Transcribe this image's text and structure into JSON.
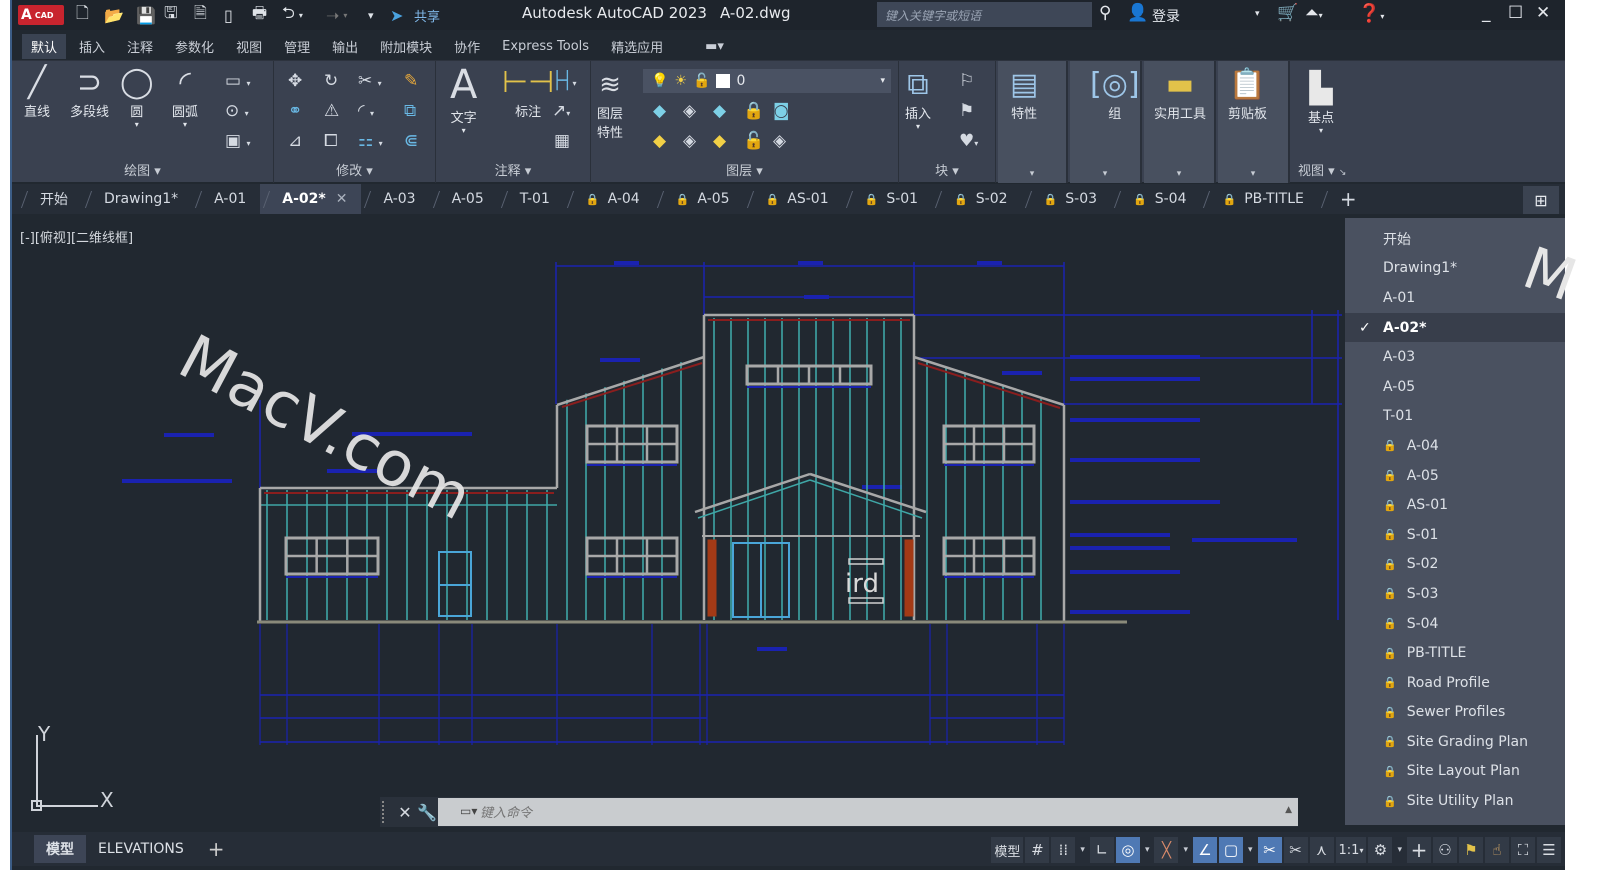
{
  "titlebar": {
    "logo_main": "A",
    "logo_sub": "CAD",
    "share_label": "共享",
    "app_title": "Autodesk AutoCAD 2023",
    "file_name": "A-02.dwg",
    "search_placeholder": "键入关键字或短语",
    "login_label": "登录",
    "quick_access_icons": [
      "new-icon",
      "open-icon",
      "save-icon",
      "save-as-icon",
      "publish-icon",
      "import-icon",
      "plot-icon",
      "undo-icon",
      "redo-icon",
      "customize-icon"
    ]
  },
  "ribbon_tabs": [
    {
      "label": "默认",
      "active": true
    },
    {
      "label": "插入"
    },
    {
      "label": "注释"
    },
    {
      "label": "参数化"
    },
    {
      "label": "视图"
    },
    {
      "label": "管理"
    },
    {
      "label": "输出"
    },
    {
      "label": "附加模块"
    },
    {
      "label": "协作"
    },
    {
      "label": "Express Tools"
    },
    {
      "label": "精选应用"
    }
  ],
  "ribbon": {
    "draw": {
      "title": "绘图",
      "line": "直线",
      "polyline": "多段线",
      "circle": "圆",
      "arc": "圆弧"
    },
    "modify": {
      "title": "修改"
    },
    "annotation": {
      "title": "注释",
      "text": "文字",
      "dimension": "标注"
    },
    "layers": {
      "title": "图层",
      "properties": "图层\n特性",
      "properties_line1": "图层",
      "properties_line2": "特性",
      "current_layer": "0"
    },
    "block": {
      "title": "块",
      "insert": "插入"
    },
    "properties": {
      "label": "特性"
    },
    "groups": {
      "label": "组"
    },
    "utilities": {
      "label": "实用工具"
    },
    "clipboard": {
      "label": "剪贴板"
    },
    "view": {
      "title": "视图",
      "base": "基点"
    }
  },
  "file_tabs": [
    {
      "label": "开始",
      "locked": false
    },
    {
      "label": "Drawing1*",
      "locked": false
    },
    {
      "label": "A-01",
      "locked": false
    },
    {
      "label": "A-02*",
      "locked": false,
      "active": true
    },
    {
      "label": "A-03",
      "locked": false
    },
    {
      "label": "A-05",
      "locked": false
    },
    {
      "label": "T-01",
      "locked": false
    },
    {
      "label": "A-04",
      "locked": true
    },
    {
      "label": "A-05",
      "locked": true
    },
    {
      "label": "AS-01",
      "locked": true
    },
    {
      "label": "S-01",
      "locked": true
    },
    {
      "label": "S-02",
      "locked": true
    },
    {
      "label": "S-03",
      "locked": true
    },
    {
      "label": "S-04",
      "locked": true
    },
    {
      "label": "PB-TITLE",
      "locked": true
    }
  ],
  "viewport": {
    "label": "[-][俯视][二维线框]",
    "ucs_x": "X",
    "ucs_y": "Y",
    "door_sign": "ird",
    "watermark": "MacV.com",
    "watermark_right": "M"
  },
  "drawing_menu": [
    {
      "label": "开始",
      "locked": false
    },
    {
      "label": "Drawing1*",
      "locked": false
    },
    {
      "label": "A-01",
      "locked": false
    },
    {
      "label": "A-02*",
      "locked": false,
      "checked": true
    },
    {
      "label": "A-03",
      "locked": false
    },
    {
      "label": "A-05",
      "locked": false
    },
    {
      "label": "T-01",
      "locked": false
    },
    {
      "label": "A-04",
      "locked": true
    },
    {
      "label": "A-05",
      "locked": true
    },
    {
      "label": "AS-01",
      "locked": true
    },
    {
      "label": "S-01",
      "locked": true
    },
    {
      "label": "S-02",
      "locked": true
    },
    {
      "label": "S-03",
      "locked": true
    },
    {
      "label": "S-04",
      "locked": true
    },
    {
      "label": "PB-TITLE",
      "locked": true
    },
    {
      "label": "Road Profile",
      "locked": true
    },
    {
      "label": "Sewer Profiles",
      "locked": true
    },
    {
      "label": "Site Grading Plan",
      "locked": true
    },
    {
      "label": "Site Layout Plan",
      "locked": true
    },
    {
      "label": "Site Utility Plan",
      "locked": true
    }
  ],
  "command_line": {
    "placeholder": "键入命令"
  },
  "layout_tabs": [
    {
      "label": "模型",
      "active": true
    },
    {
      "label": "ELEVATIONS"
    }
  ],
  "status_bar": {
    "model_label": "模型",
    "scale_label": "1:1"
  },
  "colors": {
    "canvas": "#212830",
    "dimension_blue": "#1a22b0",
    "siding_cyan": "#3fa6a6",
    "outline_gray": "#a8a8a8",
    "roof_red": "#8a1e1e",
    "column_orange": "#a33a16",
    "active_toggle": "#4f79b4"
  }
}
